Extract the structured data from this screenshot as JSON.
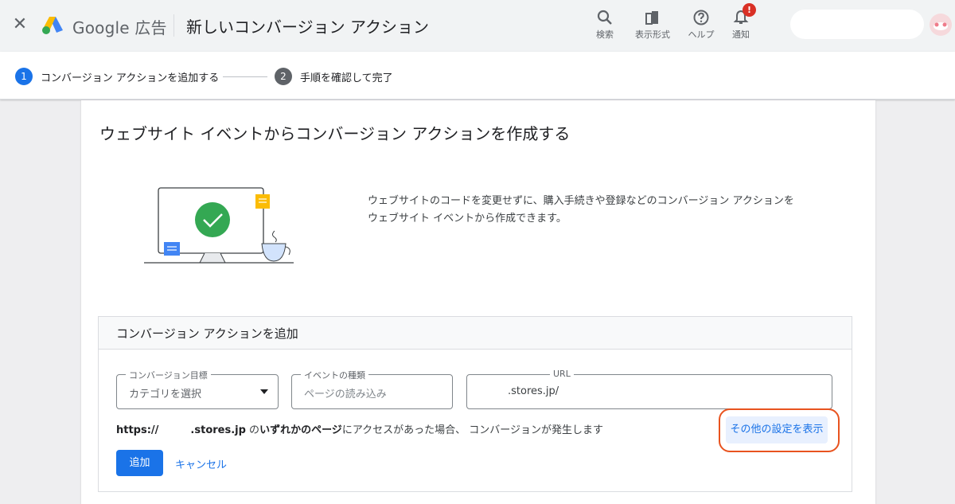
{
  "header": {
    "close_glyph": "✕",
    "brand": "Google 広告",
    "title": "新しいコンバージョン アクション",
    "tools": [
      {
        "label": "検索",
        "icon": "search-icon"
      },
      {
        "label": "表示形式",
        "icon": "appearance-icon"
      },
      {
        "label": "ヘルプ",
        "icon": "help-icon"
      },
      {
        "label": "通知",
        "icon": "bell-icon",
        "badge": "!"
      }
    ]
  },
  "stepper": {
    "steps": [
      {
        "number": "1",
        "label": "コンバージョン アクションを追加する",
        "active": true
      },
      {
        "number": "2",
        "label": "手順を確認して完了",
        "active": false
      }
    ]
  },
  "card": {
    "title": "ウェブサイト イベントからコンバージョン アクションを作成する",
    "intro_line1": "ウェブサイトのコードを変更せずに、購入手続きや登録などのコンバージョン アクションを",
    "intro_line2": "ウェブサイト イベントから作成できます。"
  },
  "form": {
    "section_title": "コンバージョン アクションを追加",
    "goal_label": "コンバージョン目標",
    "goal_value": "カテゴリを選択",
    "event_label": "イベントの種類",
    "event_placeholder": "ページの読み込み",
    "url_label": "URL",
    "url_value": ".stores.jp/",
    "notice_prefix": "https://",
    "notice_domain": ".stores.jp",
    "notice_mid": " の",
    "notice_bold": "いずれかのページ",
    "notice_suffix": "にアクセスがあった場合、 コンバージョンが発生します",
    "more_settings": "その他の設定を表示",
    "add": "追加",
    "cancel": "キャンセル"
  },
  "colors": {
    "accent": "#1a73e8",
    "highlight": "#e8531f",
    "success": "#34a853",
    "notification": "#d93025"
  }
}
